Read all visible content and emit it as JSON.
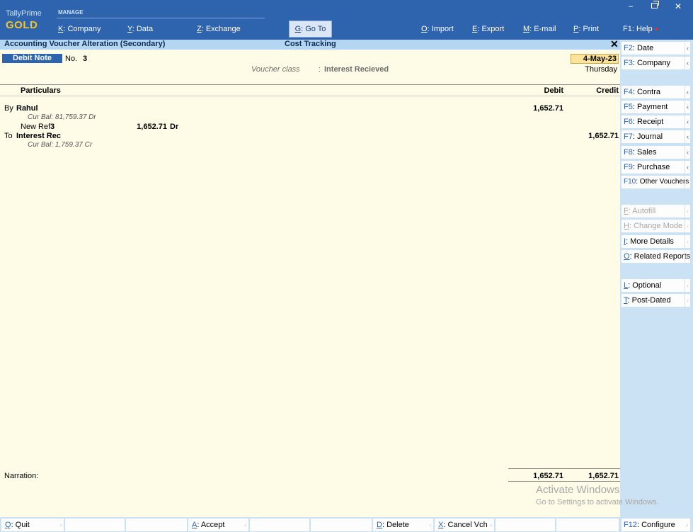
{
  "app": {
    "brand_name": "TallyPrime",
    "brand_edition": "GOLD",
    "manage_label": "MANAGE"
  },
  "top_menu": {
    "company": {
      "key": "K",
      "label": ": Company"
    },
    "data": {
      "key": "Y",
      "label": ": Data"
    },
    "exchange": {
      "key": "Z",
      "label": ": Exchange"
    },
    "goto": {
      "key": "G",
      "label": ": Go To"
    },
    "import": {
      "key": "O",
      "label": ": Import"
    },
    "export": {
      "key": "E",
      "label": ": Export"
    },
    "email": {
      "key": "M",
      "label": ": E-mail"
    },
    "print": {
      "key": "P",
      "label": ": Print"
    },
    "help": {
      "key": "F1",
      "label": ": Help"
    }
  },
  "window_controls": {
    "minimize": "–",
    "close": "✕"
  },
  "titlebar": {
    "left": "Accounting Voucher Alteration (Secondary)",
    "center": "Cost Tracking",
    "close": "✕"
  },
  "voucher": {
    "type": "Debit Note",
    "no_label": "No.",
    "no": "3",
    "class_label": "Voucher class",
    "class_sep": ":",
    "class_value": "Interest Recieved",
    "date": "4-May-23",
    "day": "Thursday"
  },
  "columns": {
    "particulars": "Particulars",
    "debit": "Debit",
    "credit": "Credit"
  },
  "entries": [
    {
      "type": "By",
      "ledger": "Rahul",
      "cur_bal": "Cur Bal:  81,759.37 Dr",
      "debit": "1,652.71",
      "credit": "",
      "bill": {
        "ref_type": "New Ref",
        "ref_no": "3",
        "amount": "1,652.71",
        "drcr": "Dr"
      }
    },
    {
      "type": "To",
      "ledger": "Interest Rec",
      "cur_bal": "Cur Bal:  1,759.37 Cr",
      "debit": "",
      "credit": "1,652.71"
    }
  ],
  "narration_label": "Narration:",
  "totals": {
    "debit": "1,652.71",
    "credit": "1,652.71"
  },
  "watermark": {
    "title": "Activate Windows",
    "subtitle": "Go to Settings to activate Windows."
  },
  "sidebar": [
    {
      "key": "F2",
      "label": ": Date",
      "enabled": true
    },
    {
      "key": "F3",
      "label": ": Company",
      "enabled": true
    },
    {
      "key": "F4",
      "label": ": Contra",
      "enabled": true
    },
    {
      "key": "F5",
      "label": ": Payment",
      "enabled": true
    },
    {
      "key": "F6",
      "label": ": Receipt",
      "enabled": true
    },
    {
      "key": "F7",
      "label": ": Journal",
      "enabled": true
    },
    {
      "key": "F8",
      "label": ": Sales",
      "enabled": true
    },
    {
      "key": "F9",
      "label": ": Purchase",
      "enabled": true
    },
    {
      "key": "F10",
      "label": ": Other Vouchers",
      "enabled": true
    },
    {
      "key": "F",
      "label": ": Autofill",
      "enabled": false
    },
    {
      "key": "H",
      "label": ": Change Mode",
      "enabled": false
    },
    {
      "key": "I",
      "label": ": More Details",
      "enabled": true
    },
    {
      "key": "O",
      "label": ": Related Reports",
      "enabled": true
    },
    {
      "key": "L",
      "label": ": Optional",
      "enabled": true
    },
    {
      "key": "T",
      "label": ": Post-Dated",
      "enabled": true
    }
  ],
  "bottom_bar": {
    "quit": {
      "key": "Q",
      "label": ": Quit"
    },
    "accept": {
      "key": "A",
      "label": ": Accept"
    },
    "delete": {
      "key": "D",
      "label": ": Delete"
    },
    "cancel": {
      "key": "X",
      "label": ": Cancel Vch"
    },
    "configure": {
      "key": "F12",
      "label": ": Configure"
    }
  },
  "colors": {
    "topbar": "#2d64ad",
    "titlebar": "#b5d6f3",
    "main_bg": "#fefbe7",
    "sidebar_bg": "#cbe1f4",
    "brand_gold": "#f1c232",
    "date_highlight": "#fbe39c"
  }
}
